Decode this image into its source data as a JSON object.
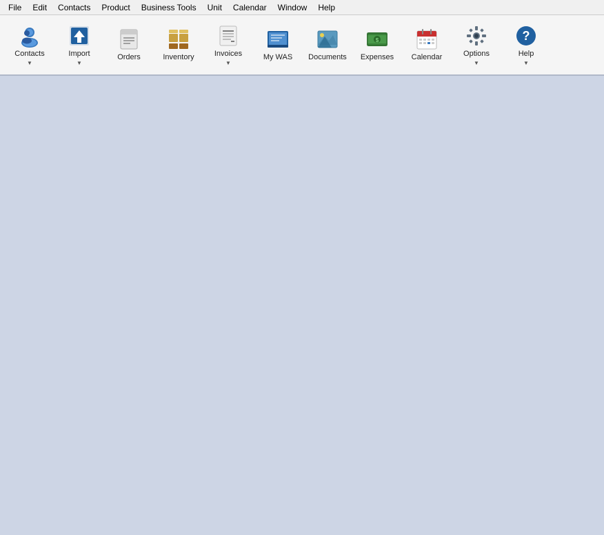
{
  "menubar": {
    "items": [
      {
        "label": "File"
      },
      {
        "label": "Edit"
      },
      {
        "label": "Contacts"
      },
      {
        "label": "Product"
      },
      {
        "label": "Business Tools"
      },
      {
        "label": "Unit"
      },
      {
        "label": "Calendar"
      },
      {
        "label": "Window"
      },
      {
        "label": "Help"
      }
    ]
  },
  "toolbar": {
    "buttons": [
      {
        "id": "contacts",
        "label": "Contacts",
        "has_chevron": true
      },
      {
        "id": "import",
        "label": "Import",
        "has_chevron": true
      },
      {
        "id": "orders",
        "label": "Orders",
        "has_chevron": false
      },
      {
        "id": "inventory",
        "label": "Inventory",
        "has_chevron": false
      },
      {
        "id": "invoices",
        "label": "Invoices",
        "has_chevron": true
      },
      {
        "id": "my-was",
        "label": "My WAS",
        "has_chevron": false
      },
      {
        "id": "documents",
        "label": "Documents",
        "has_chevron": false
      },
      {
        "id": "expenses",
        "label": "Expenses",
        "has_chevron": false
      },
      {
        "id": "calendar",
        "label": "Calendar",
        "has_chevron": false
      },
      {
        "id": "options",
        "label": "Options",
        "has_chevron": true
      },
      {
        "id": "help",
        "label": "Help",
        "has_chevron": true
      }
    ]
  }
}
